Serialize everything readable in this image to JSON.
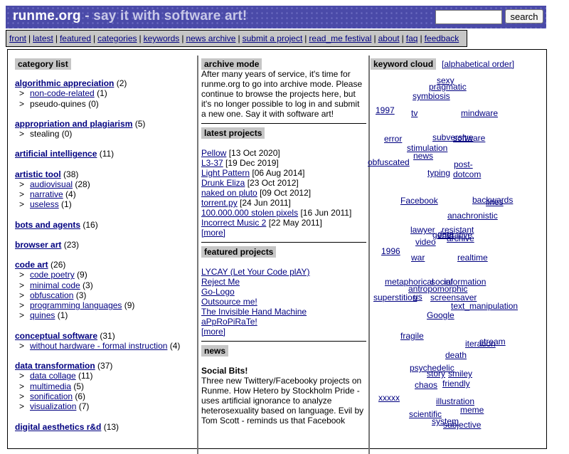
{
  "header": {
    "site": "runme.org",
    "tagline": " - say it with software art!",
    "search_placeholder": "",
    "search_label": "search"
  },
  "nav": [
    "front",
    "latest",
    "featured",
    "categories",
    "keywords",
    "news archive",
    "submit a project",
    "read_me festival",
    "about",
    "faq",
    "feedback"
  ],
  "left": {
    "heading": "category list",
    "categories": [
      {
        "name": "algorithmic appreciation",
        "count": "(2)",
        "subs": [
          {
            "name": "non-code-related",
            "count": "(1)",
            "link": true
          },
          {
            "name": "pseudo-quines",
            "count": "(0)",
            "link": false
          }
        ]
      },
      {
        "name": "appropriation and plagiarism",
        "count": "(5)",
        "subs": [
          {
            "name": "stealing",
            "count": "(0)",
            "link": false
          }
        ]
      },
      {
        "name": "artificial intelligence",
        "count": "(11)",
        "subs": []
      },
      {
        "name": "artistic tool",
        "count": "(38)",
        "subs": [
          {
            "name": "audiovisual",
            "count": "(28)",
            "link": true
          },
          {
            "name": "narrative",
            "count": "(4)",
            "link": true
          },
          {
            "name": "useless",
            "count": "(1)",
            "link": true
          }
        ]
      },
      {
        "name": "bots and agents",
        "count": "(16)",
        "subs": []
      },
      {
        "name": "browser art",
        "count": "(23)",
        "subs": []
      },
      {
        "name": "code art",
        "count": "(26)",
        "subs": [
          {
            "name": "code poetry",
            "count": "(9)",
            "link": true
          },
          {
            "name": "minimal code",
            "count": "(3)",
            "link": true
          },
          {
            "name": "obfuscation",
            "count": "(3)",
            "link": true
          },
          {
            "name": "programming languages",
            "count": "(9)",
            "link": true
          },
          {
            "name": "quines",
            "count": "(1)",
            "link": true
          }
        ]
      },
      {
        "name": "conceptual software",
        "count": "(31)",
        "subs": [
          {
            "name": "without hardware - formal instruction",
            "count": "(4)",
            "link": true
          }
        ]
      },
      {
        "name": "data transformation",
        "count": "(37)",
        "subs": [
          {
            "name": "data collage",
            "count": "(11)",
            "link": true
          },
          {
            "name": "multimedia",
            "count": "(5)",
            "link": true
          },
          {
            "name": "sonification",
            "count": "(6)",
            "link": true
          },
          {
            "name": "visualization",
            "count": "(7)",
            "link": true
          }
        ]
      },
      {
        "name": "digital aesthetics r&d",
        "count": "(13)",
        "subs": []
      }
    ]
  },
  "mid": {
    "archive_heading": "archive mode",
    "archive_text": "After many years of service, it's time for runme.org to go into archive mode. Please continue to browse the projects here, but it's no longer possible to log in and submit a new one. Say it with software art!",
    "latest_heading": "latest projects",
    "latest": [
      {
        "title": "Pellow",
        "date": "[13 Oct 2020]"
      },
      {
        "title": "L3-37",
        "date": "[19 Dec 2019]"
      },
      {
        "title": "Light Pattern",
        "date": "[06 Aug 2014]"
      },
      {
        "title": "Drunk Eliza",
        "date": "[23 Oct 2012]"
      },
      {
        "title": "naked on pluto",
        "date": "[09 Oct 2012]"
      },
      {
        "title": "torrent.py",
        "date": "[24 Jun 2011]"
      },
      {
        "title": "100.000.000 stolen pixels",
        "date": "[16 Jun 2011]"
      },
      {
        "title": "Incorrect Music 2",
        "date": "[22 May 2011]"
      }
    ],
    "more": "[more]",
    "featured_heading": "featured projects",
    "featured": [
      "LYCAY (Let Your Code plAY)",
      "Reject Me",
      "Go-Logo",
      "Outsource me!",
      "The Invisible Hand Machine",
      "aPpRoPiRaTe!"
    ],
    "news_heading": "news",
    "news_title": "Social Bits!",
    "news_text": "Three new Twittery/Facebooky projects on Runme. How Hetero by Stockholm Pride - uses artificial ignorance to analyze heterosexuality based on language. Evil by Tom Scott - reminds us that Facebook"
  },
  "right": {
    "heading": "keyword cloud",
    "alpha": "[alphabetical order]",
    "keywords": [
      "sexy",
      "pragmatic",
      "symbiosis",
      "1997",
      "tv",
      "mindware",
      "error",
      "subversive",
      "software",
      "stimulation",
      "news",
      "obfuscated",
      "post-",
      "typing",
      "dotcom",
      "Facebook",
      "backwards",
      "lines",
      "anachronistic",
      "lawyer",
      "resistant",
      "data",
      "archive",
      "generative",
      "video",
      "1996",
      "war",
      "realtime",
      "metaphorical",
      "social",
      "information",
      "antropomorphic",
      "superstition",
      "screensaver",
      "us",
      "text_manipulation",
      "Google",
      "fragile",
      "stream",
      "iteration",
      "death",
      "psychedelic",
      "story",
      "smiley",
      "friendly",
      "chaos",
      "xxxxx",
      "illustration",
      "meme",
      "scientific",
      "system",
      "subjective"
    ]
  }
}
